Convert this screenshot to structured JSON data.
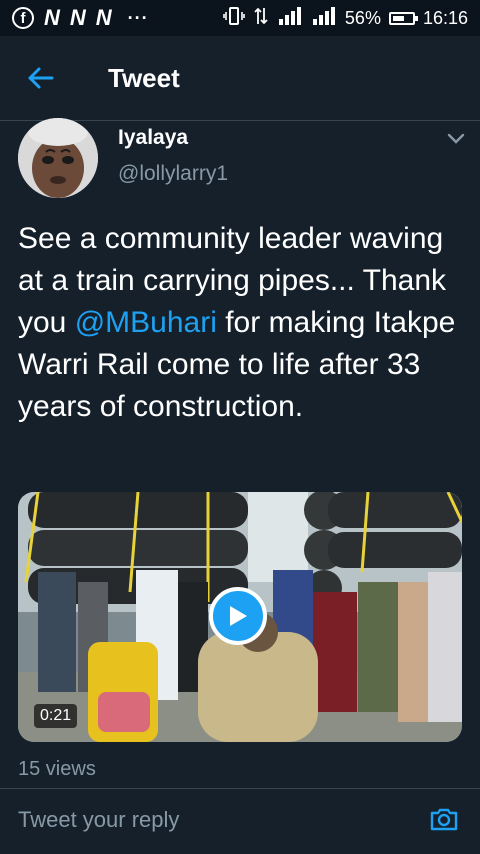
{
  "status_bar": {
    "icons_left": [
      "facebook-icon",
      "n-icon",
      "n-icon",
      "n-icon",
      "more-notifications-icon"
    ],
    "n_letter": "N",
    "dots": "···",
    "battery": "56%",
    "time": "16:16"
  },
  "header": {
    "title": "Tweet",
    "back_icon": "arrow-left-icon"
  },
  "author": {
    "name": "Iyalaya",
    "handle": "@lollylarry1",
    "avatar": "avatar"
  },
  "tweet": {
    "text_before": "See a community leader waving at a train carrying pipes... Thank you ",
    "mention": "@MBuhari",
    "text_after": " for making Itakpe Warri Rail come to life after 33 years of construction."
  },
  "media": {
    "type": "video",
    "duration": "0:21",
    "play_icon": "play-icon"
  },
  "views": "15 views",
  "reply": {
    "placeholder": "Tweet your reply",
    "camera_icon": "camera-icon"
  },
  "colors": {
    "background": "#15202b",
    "accent": "#1da1f2",
    "muted": "#8899a6",
    "divider": "#38444d"
  }
}
